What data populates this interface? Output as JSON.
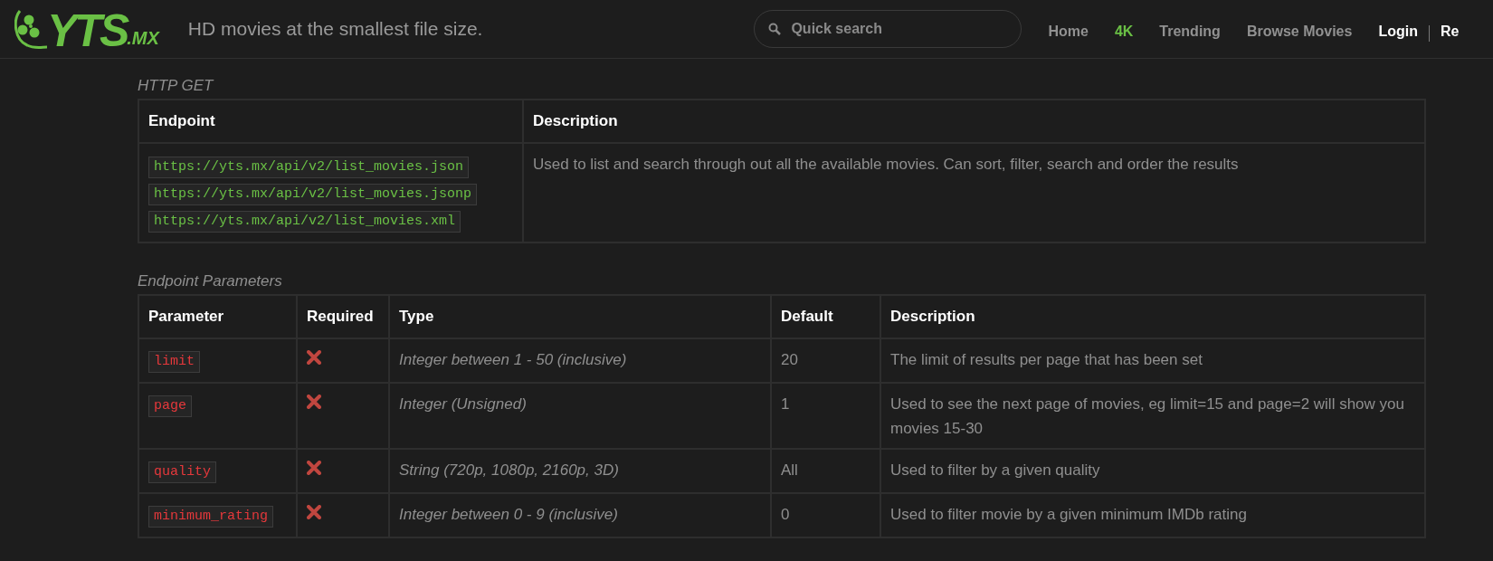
{
  "header": {
    "logo": {
      "name": "YTS",
      "suffix": ".MX"
    },
    "tagline": "HD movies at the smallest file size.",
    "search": {
      "placeholder": "Quick search"
    },
    "nav": [
      {
        "label": "Home",
        "kind": "link",
        "selected": false
      },
      {
        "label": "4K",
        "kind": "link",
        "selected": true
      },
      {
        "label": "Trending",
        "kind": "link",
        "selected": false
      },
      {
        "label": "Browse Movies",
        "kind": "link",
        "selected": false
      },
      {
        "label": "Login",
        "kind": "account",
        "selected": false
      },
      {
        "label": "Re",
        "kind": "account",
        "selected": false
      }
    ]
  },
  "http_get": {
    "title": "HTTP GET",
    "columns": [
      "Endpoint",
      "Description"
    ],
    "endpoints": [
      "https://yts.mx/api/v2/list_movies.json",
      "https://yts.mx/api/v2/list_movies.jsonp",
      "https://yts.mx/api/v2/list_movies.xml"
    ],
    "description": "Used to list and search through out all the available movies. Can sort, filter, search and order the results"
  },
  "parameters": {
    "title": "Endpoint Parameters",
    "columns": [
      "Parameter",
      "Required",
      "Type",
      "Default",
      "Description"
    ],
    "rows": [
      {
        "parameter": "limit",
        "required": false,
        "type": "Integer between 1 - 50 (inclusive)",
        "default": "20",
        "description": "The limit of results per page that has been set"
      },
      {
        "parameter": "page",
        "required": false,
        "type": "Integer (Unsigned)",
        "default": "1",
        "description": "Used to see the next page of movies, eg limit=15 and page=2 will show you movies 15-30"
      },
      {
        "parameter": "quality",
        "required": false,
        "type": "String (720p, 1080p, 2160p, 3D)",
        "default": "All",
        "description": "Used to filter by a given quality"
      },
      {
        "parameter": "minimum_rating",
        "required": false,
        "type": "Integer between 0 - 9 (inclusive)",
        "default": "0",
        "description": "Used to filter movie by a given minimum IMDb rating"
      }
    ]
  }
}
